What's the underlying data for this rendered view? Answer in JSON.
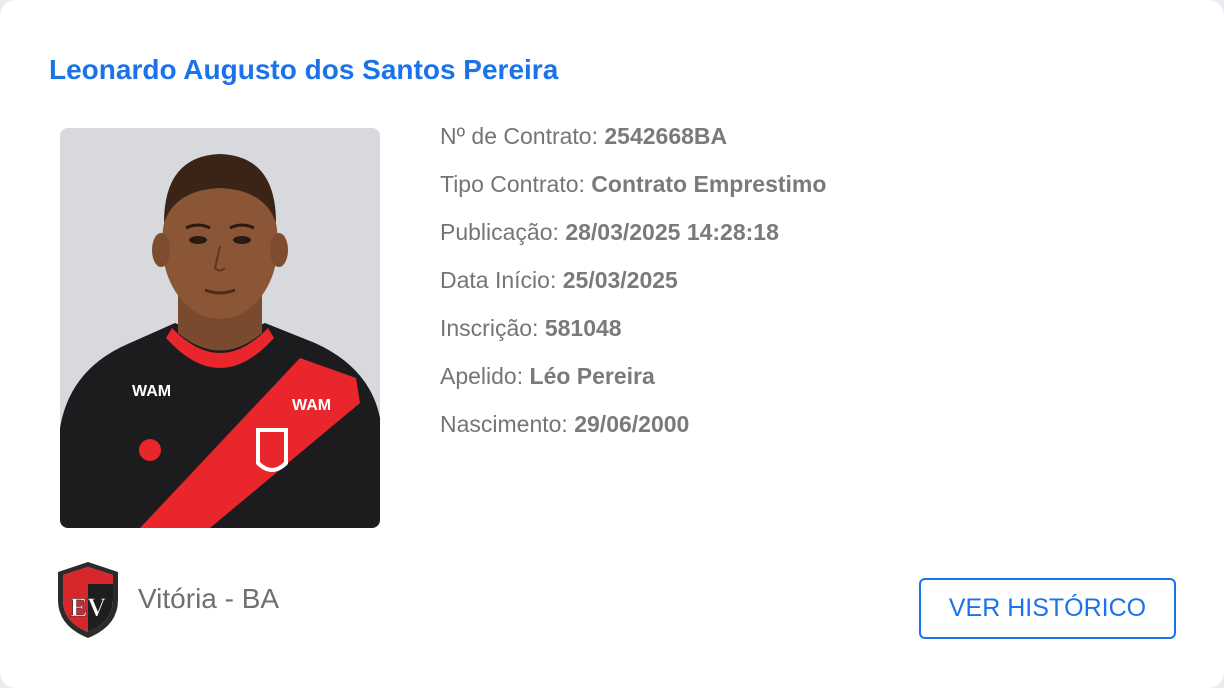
{
  "player": {
    "name": "Leonardo Augusto dos Santos Pereira",
    "photo_alt": "player-photo"
  },
  "details": [
    {
      "label": "Nº de Contrato:",
      "value": "2542668BA"
    },
    {
      "label": "Tipo Contrato:",
      "value": "Contrato Emprestimo"
    },
    {
      "label": "Publicação:",
      "value": "28/03/2025 14:28:18"
    },
    {
      "label": "Data Início:",
      "value": "25/03/2025"
    },
    {
      "label": "Inscrição:",
      "value": "581048"
    },
    {
      "label": "Apelido:",
      "value": "Léo Pereira"
    },
    {
      "label": "Nascimento:",
      "value": "29/06/2000"
    }
  ],
  "club": {
    "name": "Vitória - BA",
    "crest_icon": "club-crest-icon"
  },
  "actions": {
    "history_label": "VER HISTÓRICO"
  },
  "colors": {
    "accent": "#1a73e8",
    "text_muted": "#757575",
    "jersey_red": "#e8262c",
    "jersey_black": "#1b1b1d"
  }
}
